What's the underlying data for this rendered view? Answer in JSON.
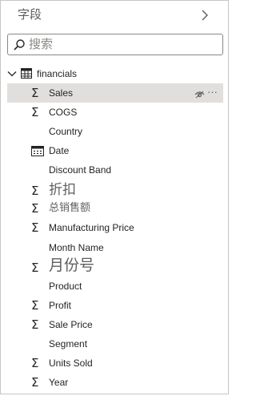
{
  "pane": {
    "title": "字段",
    "collapse_icon": "chevron-right-icon"
  },
  "search": {
    "placeholder": "搜索",
    "value": ""
  },
  "table": {
    "name": "financials",
    "expanded": true,
    "icon": "table-icon"
  },
  "fields": [
    {
      "label": "Sales",
      "icon": "sigma-icon",
      "selected": true
    },
    {
      "label": "COGS",
      "icon": "sigma-icon"
    },
    {
      "label": "Country",
      "icon": ""
    },
    {
      "label": "Date",
      "icon": "calendar-icon"
    },
    {
      "label": "Discount Band",
      "icon": ""
    },
    {
      "label": "折扣",
      "icon": "sigma-icon"
    },
    {
      "label": "总销售额",
      "icon": "sigma-icon"
    },
    {
      "label": "Manufacturing Price",
      "icon": "sigma-icon"
    },
    {
      "label": "Month Name",
      "icon": ""
    },
    {
      "label": "月份号",
      "icon": "sigma-icon"
    },
    {
      "label": "Product",
      "icon": ""
    },
    {
      "label": "Profit",
      "icon": "sigma-icon"
    },
    {
      "label": "Sale Price",
      "icon": "sigma-icon"
    },
    {
      "label": "Segment",
      "icon": ""
    },
    {
      "label": "Units Sold",
      "icon": "sigma-icon"
    },
    {
      "label": "Year",
      "icon": "sigma-icon"
    }
  ],
  "row_actions": {
    "visibility_icon": "eye-hidden-icon",
    "more_label": "···"
  }
}
